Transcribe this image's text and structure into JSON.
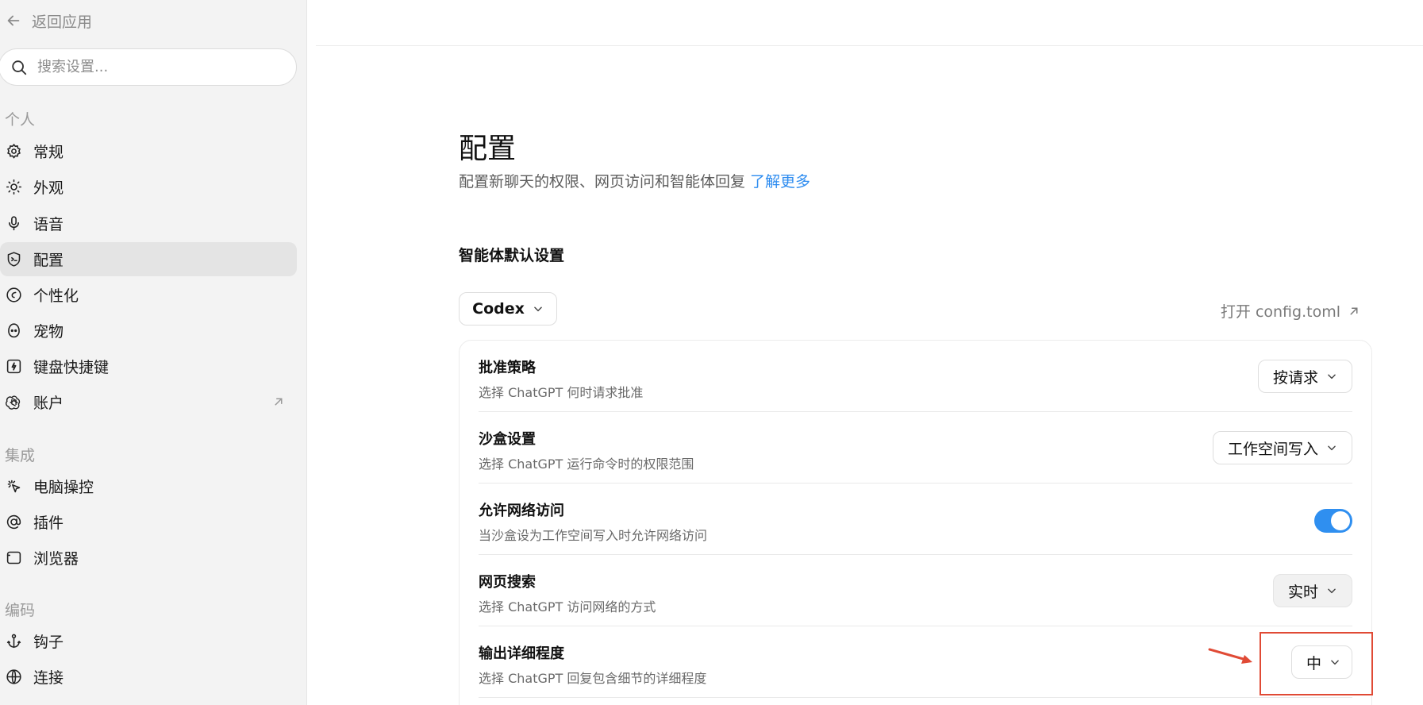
{
  "sidebar": {
    "back_label": "返回应用",
    "search_placeholder": "搜索设置...",
    "sections": {
      "personal": "个人",
      "integration": "集成",
      "coding": "编码"
    },
    "items": [
      {
        "label": "常规",
        "icon": "gear-icon"
      },
      {
        "label": "外观",
        "icon": "sun-icon"
      },
      {
        "label": "语音",
        "icon": "microphone-icon"
      },
      {
        "label": "配置",
        "icon": "shield-terminal-icon",
        "active": true
      },
      {
        "label": "个性化",
        "icon": "personalization-icon"
      },
      {
        "label": "宠物",
        "icon": "pet-icon"
      },
      {
        "label": "键盘快捷键",
        "icon": "keyboard-icon"
      },
      {
        "label": "账户",
        "icon": "openai-icon",
        "external": true
      },
      {
        "label": "电脑操控",
        "icon": "cursor-click-icon"
      },
      {
        "label": "插件",
        "icon": "at-icon"
      },
      {
        "label": "浏览器",
        "icon": "browser-icon"
      },
      {
        "label": "钩子",
        "icon": "anchor-icon"
      },
      {
        "label": "连接",
        "icon": "globe-icon"
      }
    ]
  },
  "main": {
    "title": "配置",
    "subtitle": "配置新聊天的权限、网页访问和智能体回复",
    "learn_more": "了解更多",
    "section_title": "智能体默认设置",
    "agent_select": "Codex",
    "open_config": "打开 config.toml",
    "rows": [
      {
        "label": "批准策略",
        "desc": "选择 ChatGPT 何时请求批准",
        "control": "按请求"
      },
      {
        "label": "沙盒设置",
        "desc": "选择 ChatGPT 运行命令时的权限范围",
        "control": "工作空间写入"
      },
      {
        "label": "允许网络访问",
        "desc": "当沙盒设为工作空间写入时允许网络访问",
        "control_type": "toggle",
        "enabled": true
      },
      {
        "label": "网页搜索",
        "desc": "选择 ChatGPT 访问网络的方式",
        "control": "实时"
      },
      {
        "label": "输出详细程度",
        "desc": "选择 ChatGPT 回复包含细节的详细程度",
        "control": "中"
      }
    ]
  },
  "colors": {
    "accent": "#2f8ff0",
    "annotation": "#e04a35",
    "sidebar_bg": "#f3f3f3"
  }
}
